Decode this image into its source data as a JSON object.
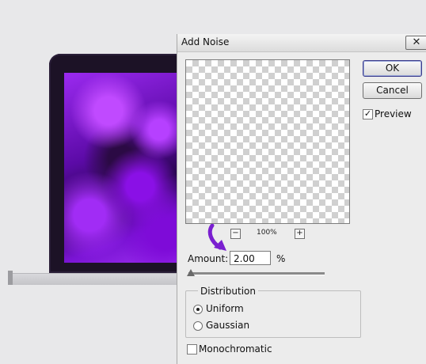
{
  "dialog": {
    "title": "Add Noise",
    "close_label": "x",
    "ok_label": "OK",
    "cancel_label": "Cancel",
    "preview_label": "Preview",
    "preview_checked": true,
    "zoom_out": "−",
    "zoom_in": "+",
    "zoom_level": "100%",
    "amount_label": "Amount:",
    "amount_value": "2.00",
    "amount_unit": "%",
    "distribution": {
      "title": "Distribution",
      "options": [
        "Uniform",
        "Gaussian"
      ],
      "selected": "Uniform"
    },
    "monochromatic_label": "Monochromatic",
    "monochromatic_checked": false
  },
  "colors": {
    "accent_arrow": "#7a1fd0",
    "laptop_screen": "#8a10e6"
  }
}
